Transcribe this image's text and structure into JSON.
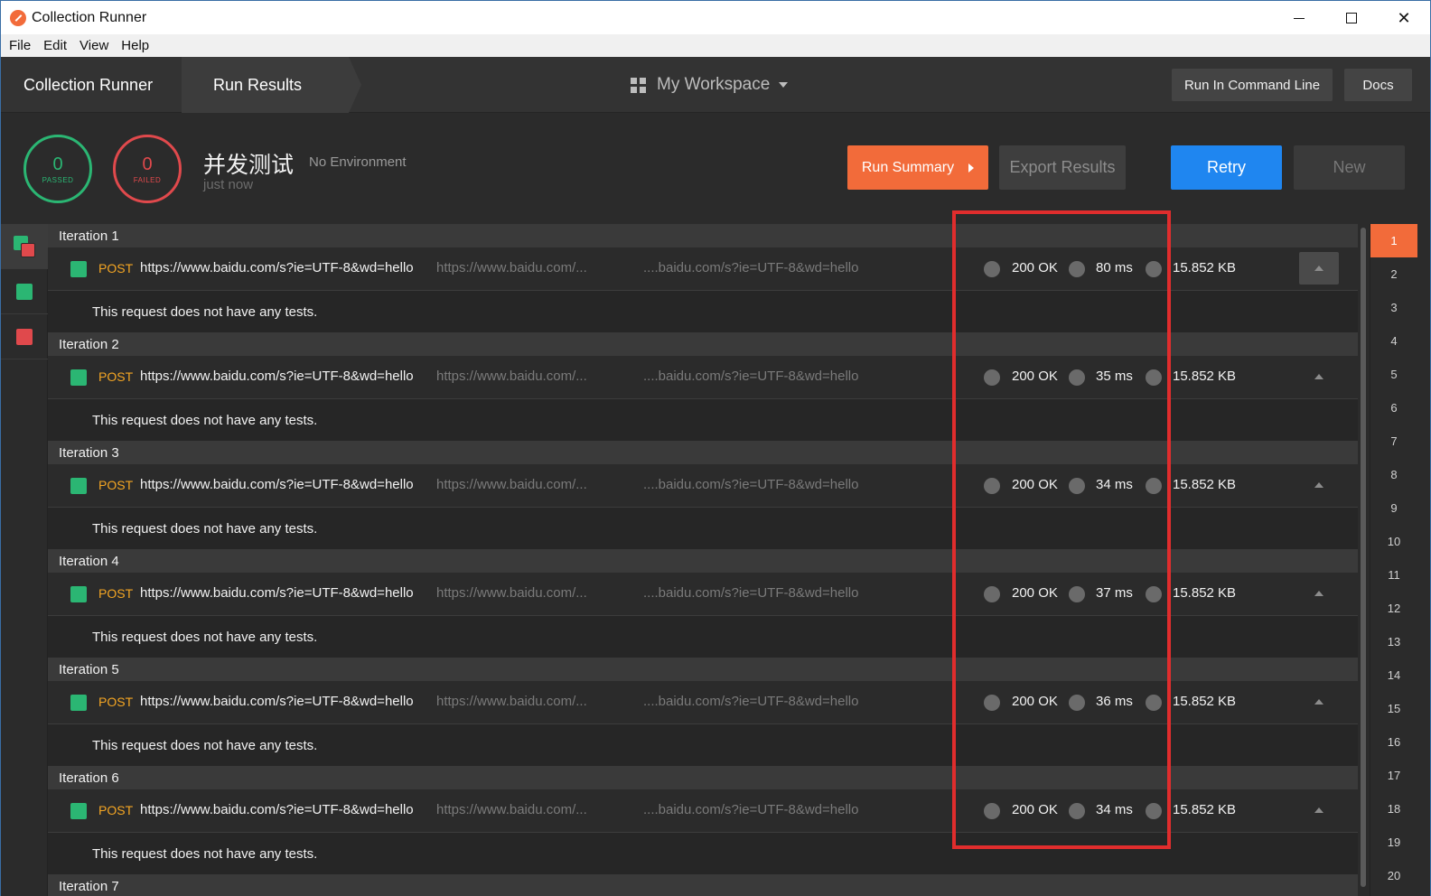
{
  "window": {
    "title": "Collection Runner",
    "min": "",
    "max": "",
    "close": "✕"
  },
  "menu": [
    "File",
    "Edit",
    "View",
    "Help"
  ],
  "nav": {
    "crumbs": [
      "Collection Runner",
      "Run Results"
    ],
    "workspace": "My Workspace",
    "run_cli": "Run In Command Line",
    "docs": "Docs"
  },
  "summary": {
    "passed_count": "0",
    "passed_label": "PASSED",
    "failed_count": "0",
    "failed_label": "FAILED",
    "collection": "并发测试",
    "environment": "No Environment",
    "time": "just now",
    "run_summary": "Run Summary",
    "export": "Export Results",
    "retry": "Retry",
    "new": "New"
  },
  "iterations": [
    {
      "label": "Iteration 1",
      "method": "POST",
      "url": "https://www.baidu.com/s?ie=UTF-8&wd=hello",
      "url_short": "https://www.baidu.com/...",
      "url_tail": "....baidu.com/s?ie=UTF-8&wd=hello",
      "code": "200 OK",
      "time": "80 ms",
      "size": "15.852 KB",
      "tests": "This request does not have any tests."
    },
    {
      "label": "Iteration 2",
      "method": "POST",
      "url": "https://www.baidu.com/s?ie=UTF-8&wd=hello",
      "url_short": "https://www.baidu.com/...",
      "url_tail": "....baidu.com/s?ie=UTF-8&wd=hello",
      "code": "200 OK",
      "time": "35 ms",
      "size": "15.852 KB",
      "tests": "This request does not have any tests."
    },
    {
      "label": "Iteration 3",
      "method": "POST",
      "url": "https://www.baidu.com/s?ie=UTF-8&wd=hello",
      "url_short": "https://www.baidu.com/...",
      "url_tail": "....baidu.com/s?ie=UTF-8&wd=hello",
      "code": "200 OK",
      "time": "34 ms",
      "size": "15.852 KB",
      "tests": "This request does not have any tests."
    },
    {
      "label": "Iteration 4",
      "method": "POST",
      "url": "https://www.baidu.com/s?ie=UTF-8&wd=hello",
      "url_short": "https://www.baidu.com/...",
      "url_tail": "....baidu.com/s?ie=UTF-8&wd=hello",
      "code": "200 OK",
      "time": "37 ms",
      "size": "15.852 KB",
      "tests": "This request does not have any tests."
    },
    {
      "label": "Iteration 5",
      "method": "POST",
      "url": "https://www.baidu.com/s?ie=UTF-8&wd=hello",
      "url_short": "https://www.baidu.com/...",
      "url_tail": "....baidu.com/s?ie=UTF-8&wd=hello",
      "code": "200 OK",
      "time": "36 ms",
      "size": "15.852 KB",
      "tests": "This request does not have any tests."
    },
    {
      "label": "Iteration 6",
      "method": "POST",
      "url": "https://www.baidu.com/s?ie=UTF-8&wd=hello",
      "url_short": "https://www.baidu.com/...",
      "url_tail": "....baidu.com/s?ie=UTF-8&wd=hello",
      "code": "200 OK",
      "time": "34 ms",
      "size": "15.852 KB",
      "tests": "This request does not have any tests."
    }
  ],
  "next_iteration_label": "Iteration 7",
  "iteration_numbers": [
    "1",
    "2",
    "3",
    "4",
    "5",
    "6",
    "7",
    "8",
    "9",
    "10",
    "11",
    "12",
    "13",
    "14",
    "15",
    "16",
    "17",
    "18",
    "19",
    "20"
  ],
  "colors": {
    "accent": "#f26b3a",
    "pass": "#2bb673",
    "fail": "#e0494c",
    "primary": "#1f86f0",
    "method_post": "#f5a623",
    "highlight": "#e02d2d"
  }
}
